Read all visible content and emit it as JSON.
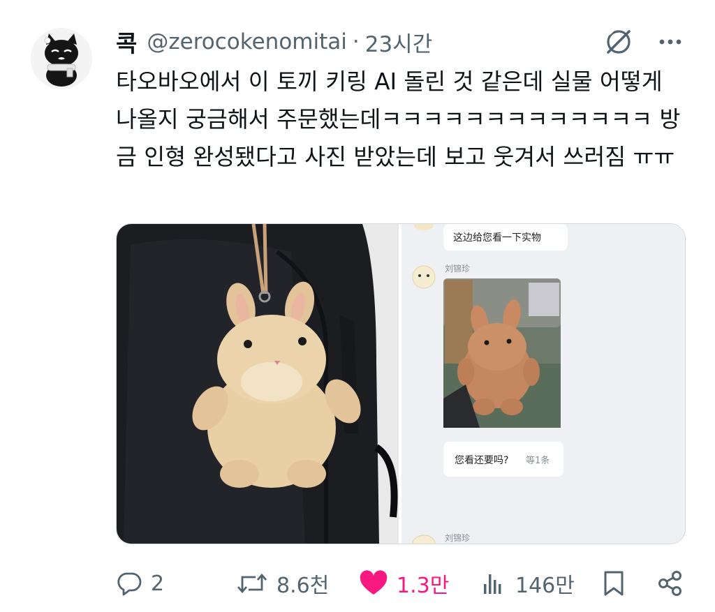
{
  "tweet": {
    "display_name": "콕",
    "handle": "@zerocokenomitai",
    "separator": "·",
    "time": "23시간",
    "text": "타오바오에서 이 토끼 키링 AI 돌린 것 같은데 실물 어떻게 나올지 궁금해서 주문했는데ㅋㅋㅋㅋㅋㅋㅋㅋㅋㅋㅋㅋㅋ 방금 인형 완성됐다고 사진 받았는데 보고 웃겨서 쓰러짐 ㅠㅠ"
  },
  "media": {
    "chat_message_1": "这边给您看一下实物",
    "sender_name_1": "刘锦珍",
    "chat_message_2_main": "您看还要吗?",
    "chat_message_2_suffix": "等1条",
    "sender_name_2": "刘锦珍"
  },
  "actions": {
    "replies": "2",
    "retweets": "8.6천",
    "likes": "1.3만",
    "views": "146만"
  },
  "colors": {
    "text": "#0f1419",
    "secondary": "#536471",
    "like": "#f91880",
    "chat_bg": "#eef0f3"
  },
  "icons": [
    "grok-icon",
    "more-icon",
    "reply-icon",
    "retweet-icon",
    "heart-icon",
    "views-icon",
    "bookmark-icon",
    "share-icon"
  ]
}
